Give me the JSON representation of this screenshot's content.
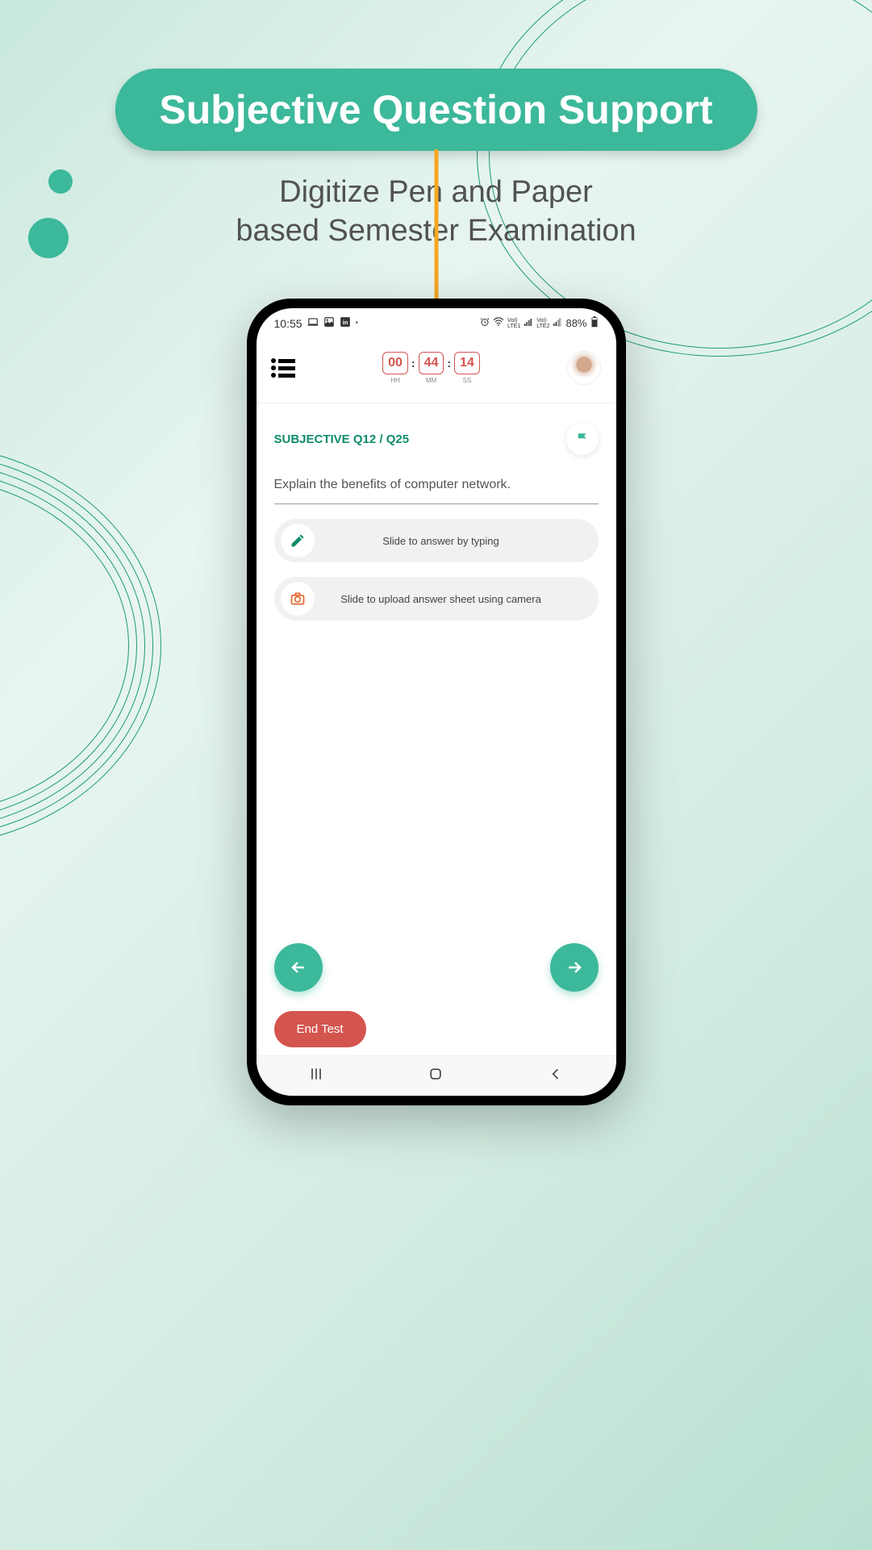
{
  "heading": "Subjective Question Support",
  "subheading_line1": "Digitize Pen and Paper",
  "subheading_line2": "based Semester Examination",
  "status": {
    "time": "10:55",
    "battery": "88%",
    "lte1": "LTE1",
    "lte2": "LTE2"
  },
  "timer": {
    "hh": {
      "value": "00",
      "label": "HH"
    },
    "mm": {
      "value": "44",
      "label": "MM"
    },
    "ss": {
      "value": "14",
      "label": "SS"
    }
  },
  "question": {
    "label": "SUBJECTIVE Q12 / Q25",
    "text": "Explain the benefits of computer network."
  },
  "slides": {
    "typing": "Slide to answer by typing",
    "camera": "Slide to upload answer sheet using camera"
  },
  "buttons": {
    "end_test": "End Test"
  }
}
